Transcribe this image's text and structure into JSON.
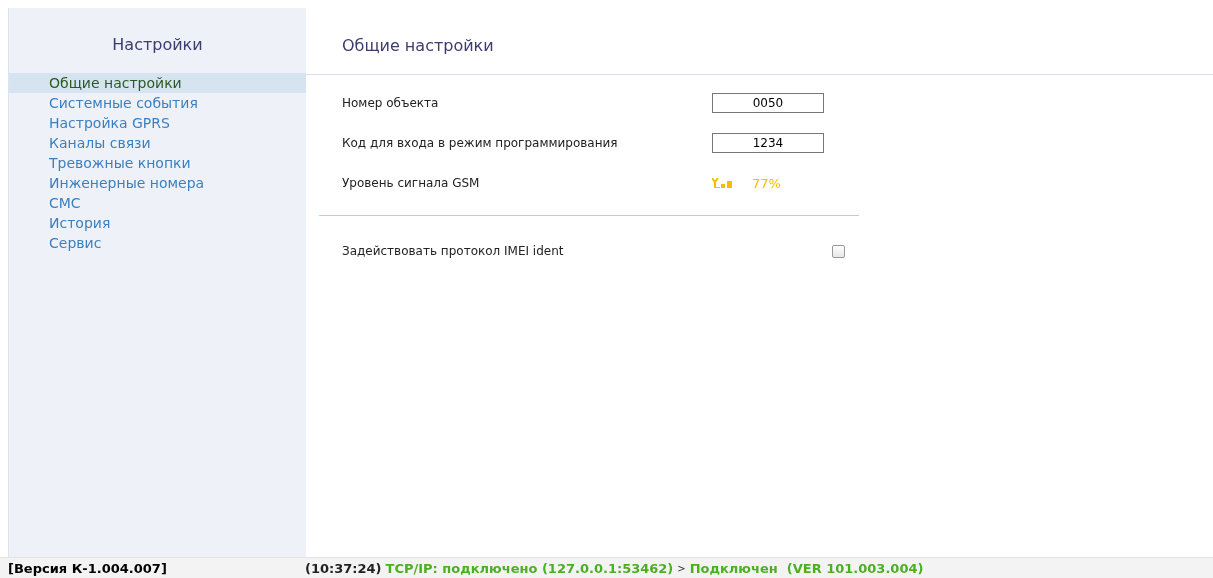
{
  "sidebar": {
    "title": "Настройки",
    "items": [
      {
        "label": "Общие настройки",
        "selected": true
      },
      {
        "label": "Системные события",
        "selected": false
      },
      {
        "label": "Настройка GPRS",
        "selected": false
      },
      {
        "label": "Каналы связи",
        "selected": false
      },
      {
        "label": "Тревожные кнопки",
        "selected": false
      },
      {
        "label": "Инженерные номера",
        "selected": false
      },
      {
        "label": "СМС",
        "selected": false
      },
      {
        "label": "История",
        "selected": false
      },
      {
        "label": "Сервис",
        "selected": false
      }
    ]
  },
  "main": {
    "title": "Общие настройки",
    "rows": [
      {
        "kind": "field",
        "label": "Номер объекта",
        "value": "0050"
      },
      {
        "kind": "field",
        "label": "Код для входа в режим программирования",
        "value": "1234"
      },
      {
        "kind": "signal",
        "label": "Уровень сигнала GSM",
        "reading": "77%"
      }
    ],
    "options": [
      {
        "label": "Задействовать протокол IMEI ident",
        "checked": false
      }
    ]
  },
  "status_bar": {
    "version": "[Версия К-1.004.007]",
    "segments": [
      {
        "kind": "time",
        "text": "(10:37:24)"
      },
      {
        "kind": "ok",
        "text": "TCP/IP: подключено (127.0.0.1:53462)"
      },
      {
        "kind": "sep",
        "text": ">"
      },
      {
        "kind": "ok",
        "text": "Подключен  (VER 101.003.004)"
      }
    ]
  }
}
